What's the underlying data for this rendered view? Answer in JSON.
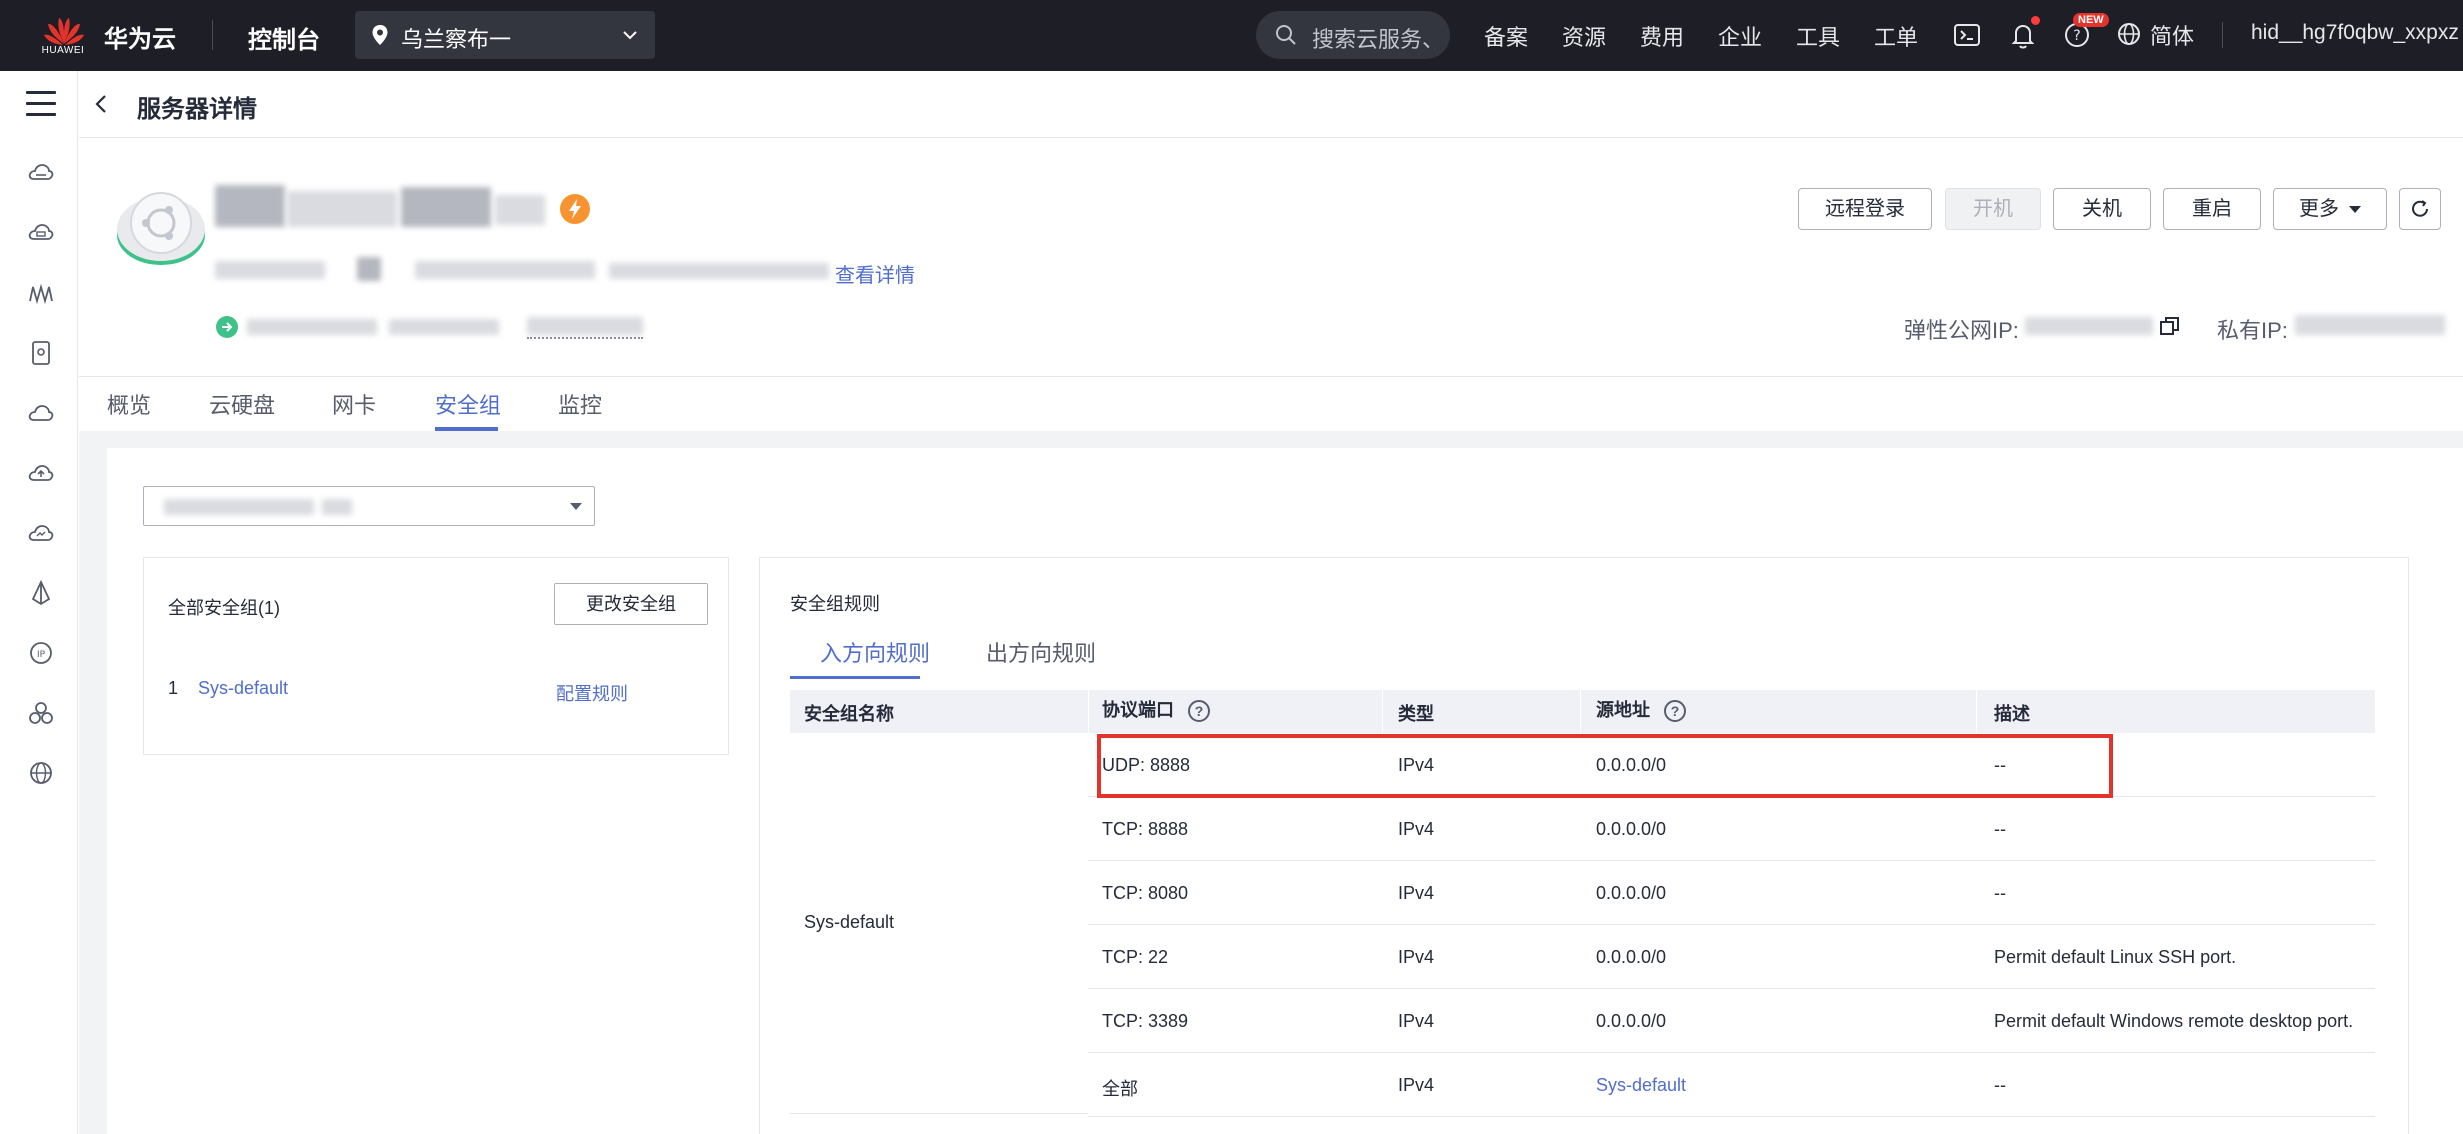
{
  "topnav": {
    "logo_text": "HUAWEI",
    "brand": "华为云",
    "console": "控制台",
    "region": "乌兰察布一",
    "search_placeholder": "搜索云服务、",
    "menu": [
      "备案",
      "资源",
      "费用",
      "企业",
      "工具",
      "工单"
    ],
    "new_badge": "NEW",
    "language": "简体",
    "user": "hid__hg7f0qbw_xxpxz"
  },
  "page": {
    "title": "服务器详情"
  },
  "summary": {
    "detail_link": "查看详情",
    "actions": {
      "remote_login": "远程登录",
      "power_on": "开机",
      "power_off": "关机",
      "restart": "重启",
      "more": "更多"
    },
    "public_ip_label": "弹性公网IP:",
    "private_ip_label": "私有IP:"
  },
  "tabs": [
    "概览",
    "云硬盘",
    "网卡",
    "安全组",
    "监控"
  ],
  "security_groups": {
    "all_label": "全部安全组(1)",
    "change_button": "更改安全组",
    "items": [
      {
        "index": "1",
        "name": "Sys-default",
        "config_link": "配置规则"
      }
    ]
  },
  "rules": {
    "title": "安全组规则",
    "tabs": [
      "入方向规则",
      "出方向规则"
    ],
    "columns": [
      "安全组名称",
      "协议端口",
      "类型",
      "源地址",
      "描述"
    ],
    "group_name": "Sys-default",
    "rows": [
      {
        "port": "UDP: 8888",
        "type": "IPv4",
        "source": "0.0.0.0/0",
        "desc": "--"
      },
      {
        "port": "TCP: 8888",
        "type": "IPv4",
        "source": "0.0.0.0/0",
        "desc": "--"
      },
      {
        "port": "TCP: 8080",
        "type": "IPv4",
        "source": "0.0.0.0/0",
        "desc": "--"
      },
      {
        "port": "TCP: 22",
        "type": "IPv4",
        "source": "0.0.0.0/0",
        "desc": "Permit default Linux SSH port."
      },
      {
        "port": "TCP: 3389",
        "type": "IPv4",
        "source": "0.0.0.0/0",
        "desc": "Permit default Windows remote desktop port."
      },
      {
        "port": "全部",
        "type": "IPv4",
        "source": "Sys-default",
        "desc": "--"
      }
    ]
  },
  "colors": {
    "accent": "#526ecc",
    "nav_bg": "#1e1f26",
    "highlight": "#e4332b",
    "status_green": "#3fc28a",
    "flash_orange": "#f79431"
  }
}
